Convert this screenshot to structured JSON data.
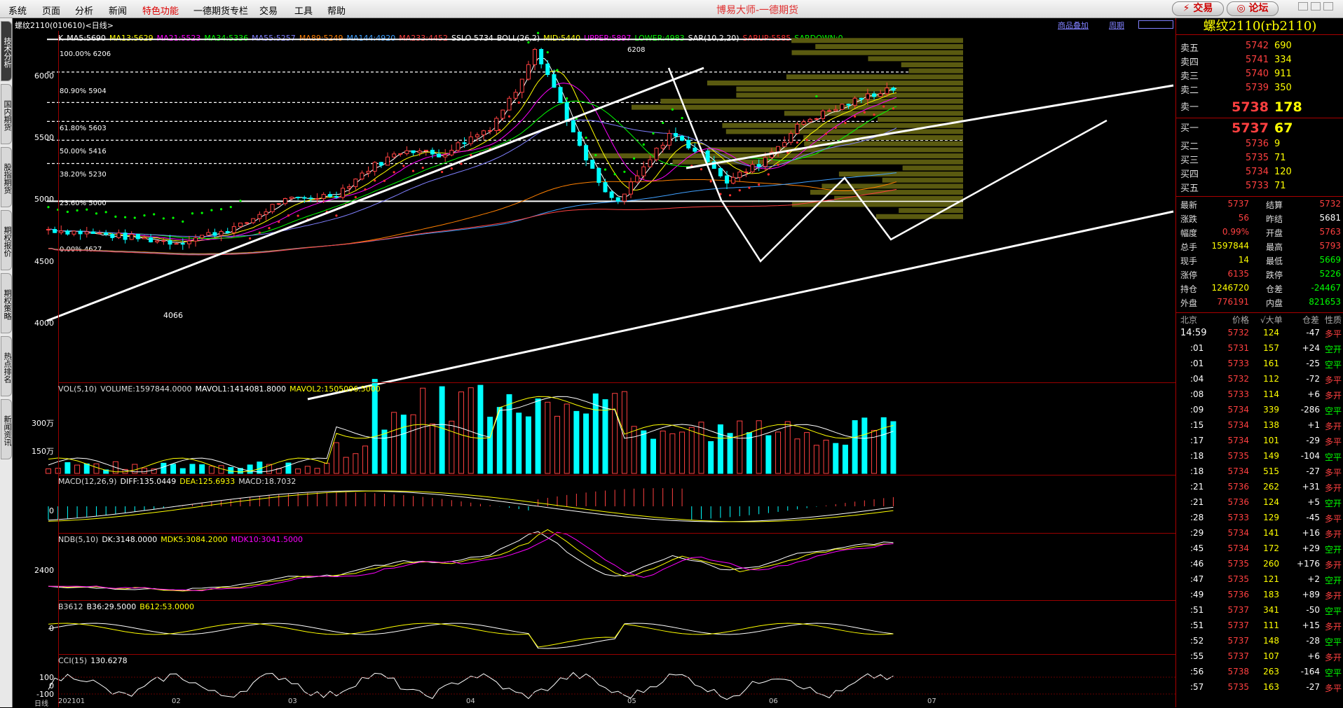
{
  "menu": [
    "系统",
    "页面",
    "分析",
    "新闻",
    "特色功能",
    "一德期货专栏",
    "交易",
    "工具",
    "帮助"
  ],
  "app_title": "博易大师-一德期货",
  "btn_trade": "⚡ 交易",
  "btn_forum": "◎ 论坛",
  "left_tabs": [
    "技术分析",
    "国内期货",
    "股指期货",
    "期权报价",
    "期权策略",
    "热点排名",
    "新闻资讯"
  ],
  "chart": {
    "instrument": "螺纹2110(010610)<日线>",
    "overlay": "商品叠加",
    "period": "周期",
    "indicators": [
      {
        "t": "K",
        "c": "#ffffff"
      },
      {
        "t": "MA5:5690",
        "c": "#ffffff"
      },
      {
        "t": "MA13:5629",
        "c": "#ffff00"
      },
      {
        "t": "MA21:5523",
        "c": "#ff00ff"
      },
      {
        "t": "MA34:5336",
        "c": "#00ff00"
      },
      {
        "t": "MA55:5257",
        "c": "#8080ff"
      },
      {
        "t": "MA89:5249",
        "c": "#ff8000"
      },
      {
        "t": "MA144:4920",
        "c": "#40a0ff"
      },
      {
        "t": "MA233:4452",
        "c": "#ff4040"
      },
      {
        "t": "SSLO 5734",
        "c": "#ffffff"
      },
      {
        "t": "BOLL(26,2)",
        "c": "#ffffff"
      },
      {
        "t": "MID:5440",
        "c": "#ffff00"
      },
      {
        "t": "UPPER:5897",
        "c": "#ff00ff"
      },
      {
        "t": "LOWER:4983",
        "c": "#00ff00"
      },
      {
        "t": "SAR(10,2,20)",
        "c": "#ffffff"
      },
      {
        "t": "SARUP:5585",
        "c": "#ff3030"
      },
      {
        "t": "SARDOWN:0",
        "c": "#00ff00"
      }
    ],
    "fib": [
      "100.00% 6206",
      "80.90% 5904",
      "61.80% 5603",
      "50.00% 5416",
      "38.20% 5230",
      "23.60% 5000",
      "0.00% 4627"
    ],
    "price_axis": [
      "6000",
      "5500",
      "5000",
      "4500",
      "4000"
    ],
    "high_label": "6208",
    "low_label": "4066",
    "vol_header": {
      "a": "VOL(5,10)",
      "b": "VOLUME:1597844.0000",
      "c": "MAVOL1:1414081.8000",
      "d": "MAVOL2:1505096.5000"
    },
    "vol_axis": [
      "300万",
      "150万"
    ],
    "macd_header": {
      "a": "MACD(12,26,9)",
      "b": "DIFF:135.0449",
      "c": "DEA:125.6933",
      "d": "MACD:18.7032"
    },
    "macd_axis": "0",
    "ndb_header": {
      "a": "NDB(5,10)",
      "b": "DK:3148.0000",
      "c": "MDK5:3084.2000",
      "d": "MDK10:3041.5000"
    },
    "ndb_axis": "2400",
    "b36_header": {
      "a": "B3612",
      "b": "B36:29.5000",
      "c": "B612:53.0000"
    },
    "b36_axis": "0",
    "cci_header": {
      "a": "CCI(15)",
      "b": "130.6278"
    },
    "cci_axis": [
      "100",
      "0",
      "-100"
    ],
    "date_axis": [
      "日线",
      "202101",
      "02",
      "03",
      "04",
      "05",
      "06",
      "07"
    ]
  },
  "panel": {
    "title": "螺纹2110(rb2110)",
    "asks": [
      {
        "l": "卖五",
        "p": "5742",
        "v": "690"
      },
      {
        "l": "卖四",
        "p": "5741",
        "v": "334"
      },
      {
        "l": "卖三",
        "p": "5740",
        "v": "911"
      },
      {
        "l": "卖二",
        "p": "5739",
        "v": "350"
      },
      {
        "l": "卖一",
        "p": "5738",
        "v": "178"
      }
    ],
    "bids": [
      {
        "l": "买一",
        "p": "5737",
        "v": "67"
      },
      {
        "l": "买二",
        "p": "5736",
        "v": "9"
      },
      {
        "l": "买三",
        "p": "5735",
        "v": "71"
      },
      {
        "l": "买四",
        "p": "5734",
        "v": "120"
      },
      {
        "l": "买五",
        "p": "5733",
        "v": "71"
      }
    ],
    "quote": [
      {
        "a": "最新",
        "b": "5737",
        "c": "结算",
        "d": "5732",
        "bc": "#ff4040",
        "dc": "#ff4040"
      },
      {
        "a": "涨跌",
        "b": "56",
        "c": "昨结",
        "d": "5681",
        "bc": "#ff4040",
        "dc": "#ffffff"
      },
      {
        "a": "幅度",
        "b": "0.99%",
        "c": "开盘",
        "d": "5763",
        "bc": "#ff4040",
        "dc": "#ff4040"
      },
      {
        "a": "总手",
        "b": "1597844",
        "c": "最高",
        "d": "5793",
        "bc": "#ffff00",
        "dc": "#ff4040"
      },
      {
        "a": "现手",
        "b": "14",
        "c": "最低",
        "d": "5669",
        "bc": "#ffff00",
        "dc": "#00ff00"
      },
      {
        "a": "涨停",
        "b": "6135",
        "c": "跌停",
        "d": "5226",
        "bc": "#ff4040",
        "dc": "#00ff00"
      },
      {
        "a": "持仓",
        "b": "1246720",
        "c": "仓差",
        "d": "-24467",
        "bc": "#ffff00",
        "dc": "#00ff00"
      },
      {
        "a": "外盘",
        "b": "776191",
        "c": "内盘",
        "d": "821653",
        "bc": "#ff4040",
        "dc": "#00ff00"
      }
    ],
    "ticks_header": [
      "北京",
      "价格",
      "√大单",
      "仓差",
      "性质"
    ],
    "ticks": [
      {
        "t": "14:59",
        "p": "5732",
        "v": "124",
        "d": "-47",
        "n": "多平"
      },
      {
        "t": ":01",
        "p": "5731",
        "v": "157",
        "d": "+24",
        "n": "空开"
      },
      {
        "t": ":01",
        "p": "5733",
        "v": "161",
        "d": "-25",
        "n": "空平"
      },
      {
        "t": ":04",
        "p": "5732",
        "v": "112",
        "d": "-72",
        "n": "多平"
      },
      {
        "t": ":08",
        "p": "5733",
        "v": "114",
        "d": "+6",
        "n": "多开"
      },
      {
        "t": ":09",
        "p": "5734",
        "v": "339",
        "d": "-286",
        "n": "空平"
      },
      {
        "t": ":15",
        "p": "5734",
        "v": "138",
        "d": "+1",
        "n": "多开"
      },
      {
        "t": ":17",
        "p": "5734",
        "v": "101",
        "d": "-29",
        "n": "多平"
      },
      {
        "t": ":18",
        "p": "5735",
        "v": "149",
        "d": "-104",
        "n": "空平"
      },
      {
        "t": ":18",
        "p": "5734",
        "v": "515",
        "d": "-27",
        "n": "多平"
      },
      {
        "t": ":21",
        "p": "5736",
        "v": "262",
        "d": "+31",
        "n": "多开"
      },
      {
        "t": ":21",
        "p": "5736",
        "v": "124",
        "d": "+5",
        "n": "空开"
      },
      {
        "t": ":28",
        "p": "5733",
        "v": "129",
        "d": "-45",
        "n": "多平"
      },
      {
        "t": ":29",
        "p": "5734",
        "v": "141",
        "d": "+16",
        "n": "多开"
      },
      {
        "t": ":45",
        "p": "5734",
        "v": "172",
        "d": "+29",
        "n": "空开"
      },
      {
        "t": ":46",
        "p": "5735",
        "v": "260",
        "d": "+176",
        "n": "多开"
      },
      {
        "t": ":47",
        "p": "5735",
        "v": "121",
        "d": "+2",
        "n": "空开"
      },
      {
        "t": ":49",
        "p": "5736",
        "v": "183",
        "d": "+89",
        "n": "多开"
      },
      {
        "t": ":51",
        "p": "5737",
        "v": "341",
        "d": "-50",
        "n": "空平"
      },
      {
        "t": ":51",
        "p": "5737",
        "v": "111",
        "d": "+15",
        "n": "多开"
      },
      {
        "t": ":52",
        "p": "5737",
        "v": "148",
        "d": "-28",
        "n": "空平"
      },
      {
        "t": ":55",
        "p": "5737",
        "v": "107",
        "d": "+6",
        "n": "多开"
      },
      {
        "t": ":56",
        "p": "5738",
        "v": "263",
        "d": "-164",
        "n": "空平"
      },
      {
        "t": ":57",
        "p": "5735",
        "v": "163",
        "d": "-27",
        "n": "多平"
      }
    ]
  }
}
